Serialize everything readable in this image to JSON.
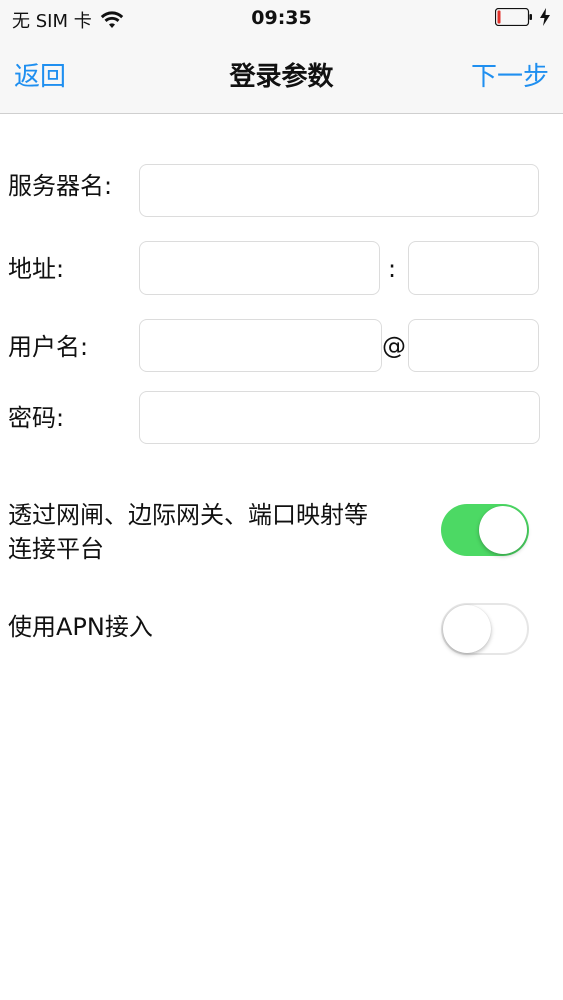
{
  "status_bar": {
    "carrier": "无 SIM 卡",
    "time": "09:35"
  },
  "nav": {
    "back_label": "返回",
    "title": "登录参数",
    "next_label": "下一步"
  },
  "form": {
    "server_name_label": "服务器名:",
    "server_name_value": "",
    "address_label": "地址:",
    "address_value": "",
    "port_separator": ":",
    "port_value": "",
    "username_label": "用户名:",
    "username_value": "",
    "domain_separator": "@",
    "domain_value": "",
    "password_label": "密码:",
    "password_value": ""
  },
  "toggles": {
    "gateway_label": "透过网闸、边际网关、端口映射等连接平台",
    "gateway_on": true,
    "apn_label": "使用APN接入",
    "apn_on": false
  },
  "colors": {
    "accent": "#1f8ff0",
    "toggle_on": "#4cd964"
  }
}
